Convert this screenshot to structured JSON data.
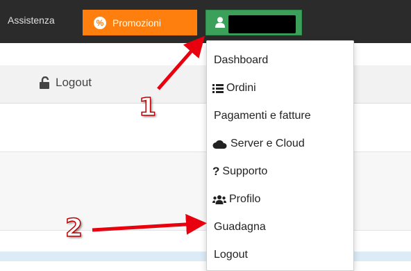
{
  "topbar": {
    "assistance_label": "Assistenza",
    "promo_label": "Promozioni",
    "promo_icon": "%",
    "user_name": ""
  },
  "subnav": {
    "logout_label": "Logout"
  },
  "dropdown": {
    "items": [
      {
        "label": "Dashboard",
        "icon": ""
      },
      {
        "label": "Ordini",
        "icon": "list-icon"
      },
      {
        "label": "Pagamenti e fatture",
        "icon": ""
      },
      {
        "label": "Server e Cloud",
        "icon": "cloud-icon"
      },
      {
        "label": "Supporto",
        "icon": "question-icon"
      },
      {
        "label": "Profilo",
        "icon": "users-icon"
      },
      {
        "label": "Guadagna",
        "icon": ""
      },
      {
        "label": "Logout",
        "icon": ""
      }
    ]
  },
  "annotations": {
    "step1": "1",
    "step2": "2"
  },
  "colors": {
    "promo": "#ff7f0e",
    "user_button": "#3aa05a",
    "arrow": "#e8000e"
  }
}
